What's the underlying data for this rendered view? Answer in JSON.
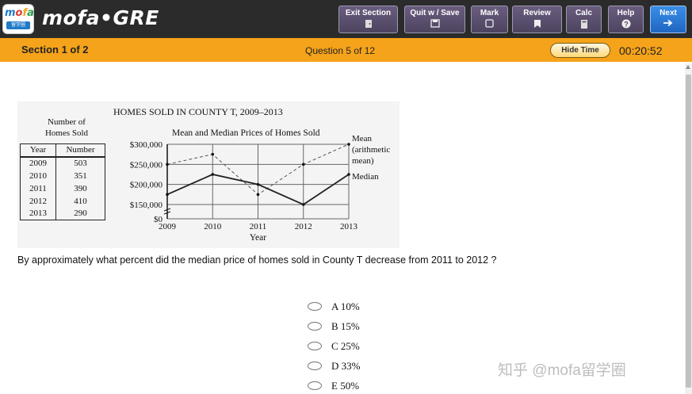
{
  "header": {
    "logo_text": "mofa",
    "logo_sub": "留学圈",
    "brand": "mofa•GRE",
    "buttons": {
      "exit_section": "Exit Section",
      "quit_save": "Quit w / Save",
      "mark": "Mark",
      "review": "Review",
      "calc": "Calc",
      "help": "Help",
      "next": "Next"
    }
  },
  "status_bar": {
    "section": "Section 1 of 2",
    "question_count": "Question 5 of 12",
    "hide_time": "Hide Time",
    "timer": "00:20:52"
  },
  "figure": {
    "title": "HOMES SOLD IN COUNTY T, 2009–2013",
    "table": {
      "title_line1": "Number of",
      "title_line2": "Homes Sold",
      "headers": [
        "Year",
        "Number"
      ],
      "rows": [
        [
          "2009",
          "503"
        ],
        [
          "2010",
          "351"
        ],
        [
          "2011",
          "390"
        ],
        [
          "2012",
          "410"
        ],
        [
          "2013",
          "290"
        ]
      ]
    }
  },
  "chart_data": {
    "type": "line",
    "title": "Mean and Median Prices of Homes Sold",
    "xlabel": "Year",
    "ylabel": "",
    "x": [
      "2009",
      "2010",
      "2011",
      "2012",
      "2013"
    ],
    "ylim": [
      0,
      300000
    ],
    "y_ticks": [
      "$0",
      "$150,000",
      "$200,000",
      "$250,000",
      "$300,000"
    ],
    "series": [
      {
        "name": "Mean (arithmetic mean)",
        "style": "dashed",
        "values": [
          250000,
          275000,
          175000,
          250000,
          300000
        ]
      },
      {
        "name": "Median",
        "style": "solid",
        "values": [
          175000,
          225000,
          200000,
          150000,
          225000
        ]
      }
    ],
    "legend_labels": {
      "mean_line1": "Mean",
      "mean_line2": "(arithmetic",
      "mean_line3": "mean)",
      "median": "Median"
    },
    "grid": true
  },
  "question": {
    "text": "By approximately what percent did the median price of homes sold in County T decrease from 2011 to 2012 ?",
    "choices": [
      "A 10%",
      "B  15%",
      "C  25%",
      "D  33%",
      "E  50%"
    ]
  },
  "watermark": "知乎 @mofa留学圈"
}
